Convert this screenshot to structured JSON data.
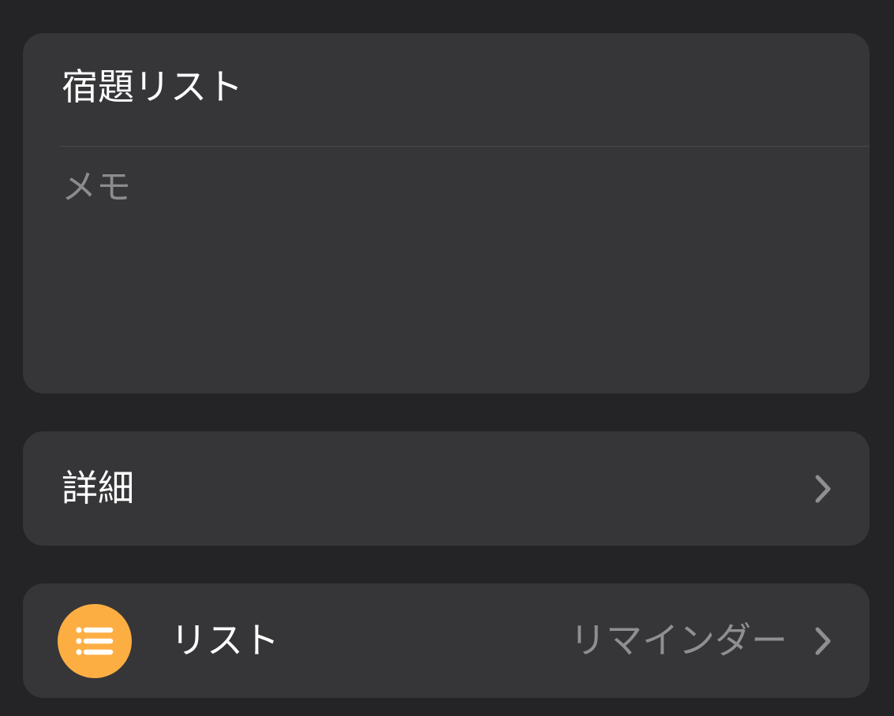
{
  "reminder": {
    "title": "宿題リスト",
    "notes_placeholder": "メモ"
  },
  "details_row": {
    "label": "詳細",
    "chevron_icon": "chevron-right-icon"
  },
  "list_row": {
    "label": "リスト",
    "value": "リマインダー",
    "icon": "list-bullet-icon",
    "icon_color": "#fdae43",
    "chevron_icon": "chevron-right-icon"
  },
  "colors": {
    "background": "#242426",
    "card": "#363638",
    "primary_text": "#ffffff",
    "secondary_text": "#8e8e93"
  }
}
